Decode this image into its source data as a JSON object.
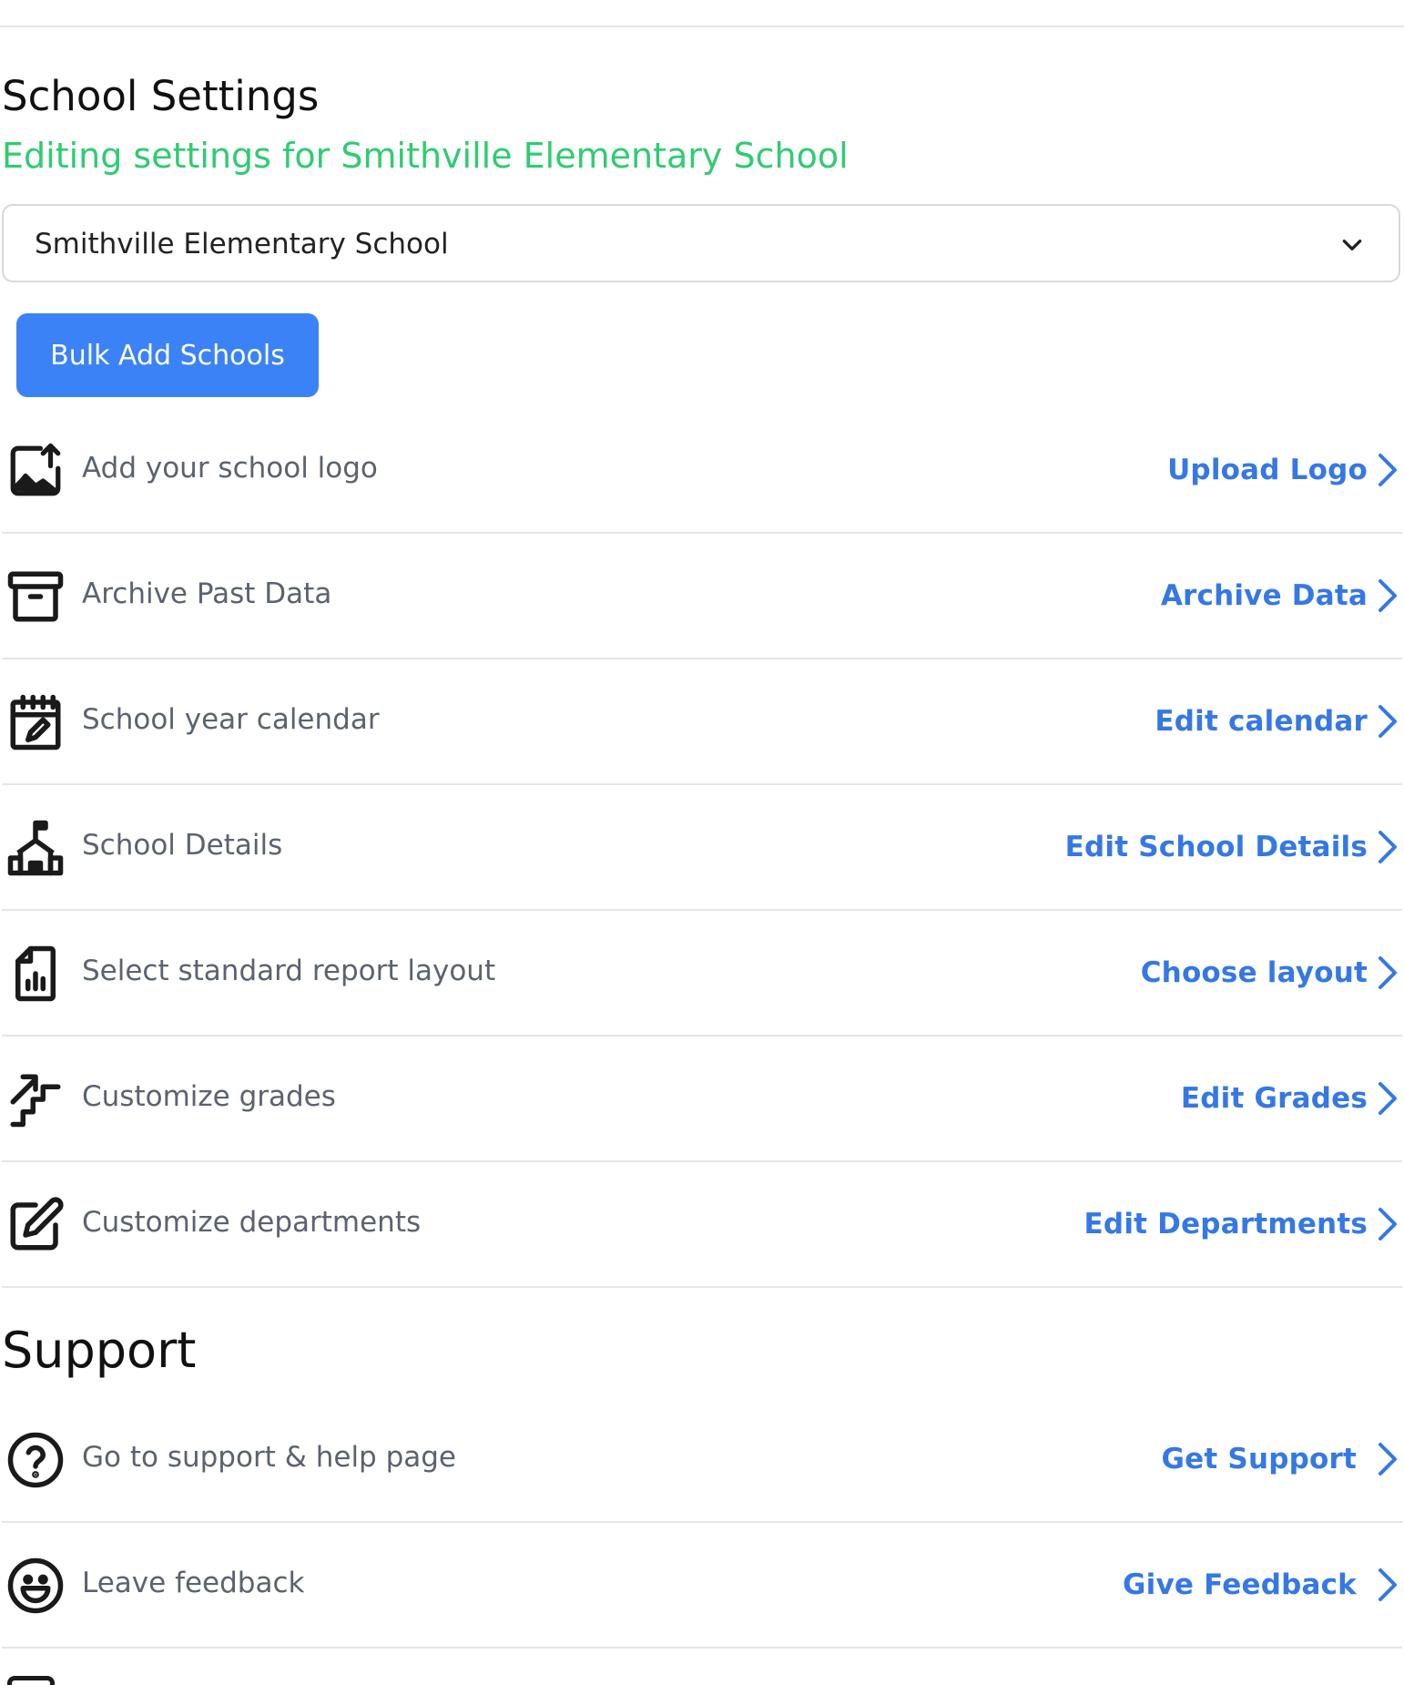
{
  "school_settings": {
    "title": "School Settings",
    "subtitle": "Editing settings for Smithville Elementary School",
    "school_select": {
      "selected": "Smithville Elementary School"
    },
    "bulk_add_label": "Bulk Add Schools",
    "rows": [
      {
        "label": "Add your school logo",
        "action": "Upload Logo",
        "icon": "image-upload-icon"
      },
      {
        "label": "Archive Past Data",
        "action": "Archive Data",
        "icon": "archive-box-icon"
      },
      {
        "label": "School year calendar",
        "action": "Edit calendar",
        "icon": "calendar-edit-icon"
      },
      {
        "label": "School Details",
        "action": "Edit School Details",
        "icon": "school-building-icon"
      },
      {
        "label": "Select standard report layout",
        "action": "Choose layout",
        "icon": "report-chart-icon"
      },
      {
        "label": "Customize grades",
        "action": "Edit Grades",
        "icon": "stairs-icon"
      },
      {
        "label": "Customize departments",
        "action": "Edit Departments",
        "icon": "pencil-square-icon"
      }
    ]
  },
  "support": {
    "title": "Support",
    "rows": [
      {
        "label": "Go to support & help page",
        "action": "Get Support",
        "icon": "question-circle-icon"
      },
      {
        "label": "Leave feedback",
        "action": "Give Feedback",
        "icon": "smiley-icon"
      }
    ]
  },
  "colors": {
    "accent_blue": "#3b82f6",
    "link_blue": "#3578e5",
    "subtitle_green": "#2ecc71",
    "label_gray": "#5b6270",
    "divider": "#e3e5e8"
  }
}
